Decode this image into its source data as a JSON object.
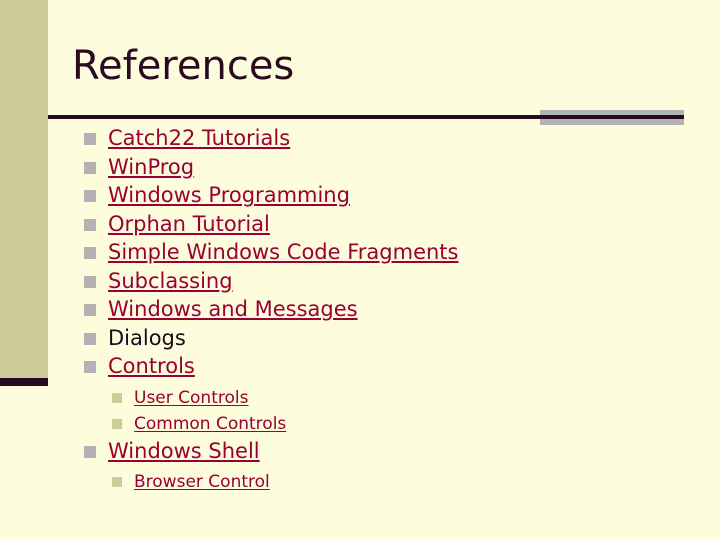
{
  "slide": {
    "title": "References",
    "background_color": "#fdfddd",
    "accent_band_color": "#cccc99",
    "rule_color": "#280a22",
    "rule_block_color": "#b3b3b3",
    "link_color": "#990033",
    "text_color": "#1a0a1a",
    "bullet_level1_color": "#b3b3b3",
    "bullet_level2_color": "#cccc99"
  },
  "content": {
    "items": [
      {
        "level": 1,
        "label": "Catch22 Tutorials",
        "link": true
      },
      {
        "level": 1,
        "label": "WinProg",
        "link": true
      },
      {
        "level": 1,
        "label": "Windows Programming",
        "link": true
      },
      {
        "level": 1,
        "label": "Orphan Tutorial",
        "link": true
      },
      {
        "level": 1,
        "label": "Simple Windows Code Fragments",
        "link": true
      },
      {
        "level": 1,
        "label": "Subclassing",
        "link": true
      },
      {
        "level": 1,
        "label": "Windows and Messages",
        "link": true
      },
      {
        "level": 1,
        "label": "Dialogs",
        "link": false
      },
      {
        "level": 1,
        "label": "Controls",
        "link": true
      },
      {
        "level": 2,
        "label": "User Controls",
        "link": true
      },
      {
        "level": 2,
        "label": "Common Controls",
        "link": true
      },
      {
        "level": 1,
        "label": "Windows Shell",
        "link": true
      },
      {
        "level": 2,
        "label": "Browser Control",
        "link": true
      }
    ]
  }
}
